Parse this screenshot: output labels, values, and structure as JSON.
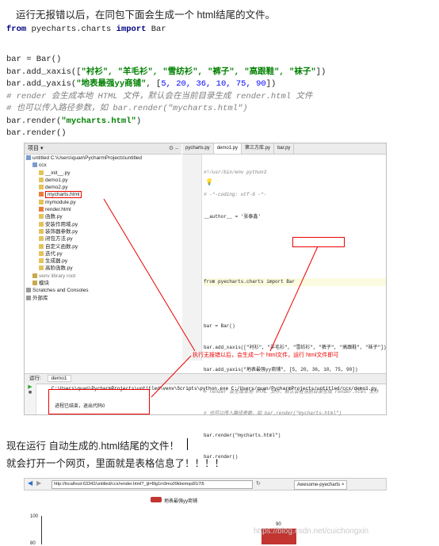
{
  "intro_text": "运行无报错以后，在同包下面会生成一个 html结尾的文件。",
  "code": {
    "line1_kw1": "from",
    "line1_mod": " pyecharts.charts ",
    "line1_kw2": "import",
    "line1_name": " Bar",
    "line2": "bar = Bar()",
    "line3_pre": "bar.add_xaxis([",
    "line3_items": "\"衬衫\", \"羊毛衫\", \"雪纺衫\", \"裤子\", \"高跟鞋\", \"袜子\"",
    "line3_post": "])",
    "line4_pre": "bar.add_yaxis(",
    "line4_str": "\"地表最强yy商铺\"",
    "line4_mid": ", [",
    "line4_nums": "5, 20, 36, 10, 75, 90",
    "line4_post": "])",
    "comment1": "# render 会生成本地 HTML 文件，默认会在当前目录生成 render.html 文件",
    "comment2": "# 也可以传入路径参数，如 bar.render(\"mycharts.html\")",
    "line7_pre": "bar.render(",
    "line7_str": "\"mycharts.html\"",
    "line7_post": ")",
    "line8": "bar.render()"
  },
  "ide": {
    "project_label": "项目 ▾",
    "tree": [
      "untitled  C:\\Users\\quan\\PycharmProjects\\untitled",
      "ccx",
      "__init__.py",
      "demo1.py",
      "demo2.py",
      "mycharts.html",
      "mymodule.py",
      "render.html",
      "函数.py",
      "安装作用域.py",
      "装饰器参数.py",
      "闭包方法.py",
      "自定义函数.py",
      "迭代.py",
      "生成器.py",
      "高阶函数.py",
      "venv  library root",
      "模块",
      "Scratches and Consoles",
      "外部库"
    ],
    "tabs": [
      "pycharts.py",
      "demo1.py",
      "第三方库.py",
      "bar.py"
    ],
    "editor_lines": [
      "#!/usr/bin/env python3",
      "# -*-coding: utf-8 -*-",
      "__author__ = '张泰鑫'",
      "",
      "",
      "from pyecharts.charts import Bar",
      "",
      "bar = Bar()",
      "bar.add_xaxis([\"衬衫\", \"羊毛衫\", \"雪纺衫\", \"裤子\", \"高跟鞋\", \"袜子\"])",
      "bar.add_yaxis(\"地表最强yy商铺\", [5, 20, 36, 10, 75, 90])",
      "# render 会生成本地 HTML 文件，默认会在当前目录生成 render.html 文件",
      "# 也可以传入路径参数，如 bar.render(\"mycharts.html\")",
      "bar.render(\"mycharts.html\")",
      "bar.render()"
    ],
    "annotation": "执行无报错以后，会生成一个 html文件，运行 html文件即可",
    "run_label": "运行:",
    "run_tab": "demo1",
    "run_cmd": "C:\\Users\\quan\\PycharmProjects\\untitled\\venv\\Scripts\\python.exe C:/Users/quan/PycharmProjects/untitled/ccx/demo1.py",
    "run_out": "进程已结束，退出代码0"
  },
  "bottom_text1": "现在运行 自动生成的.html结尾的文件！",
  "bottom_text2": "就会打开一个网页，里面就是表格信息了！！！！",
  "browser": {
    "url": "http://localhost:63342/untitled/ccx/render.html?_ijt=8lg1rn9mu09kbemqs81i7i5",
    "tab": "Awesome-pyecharts",
    "legend": "地表最强yy商铺",
    "ytick_top": "100",
    "ytick_mid": "80",
    "bar_label": "90",
    "watermark": "https://blog.csdn.net/cuichongxin",
    "accent": "#c23531"
  }
}
